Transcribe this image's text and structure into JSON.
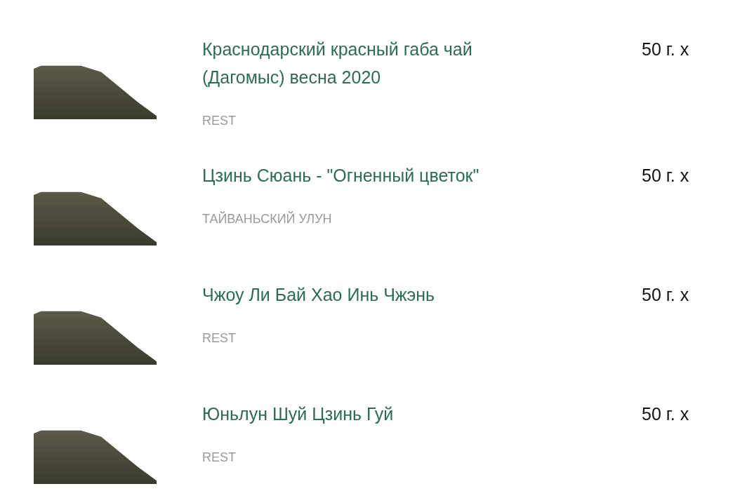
{
  "products": [
    {
      "title": "Краснодарский красный габа чай (Дагомыс) весна 2020",
      "category": "REST",
      "price": "50 г. х"
    },
    {
      "title": "Цзинь Сюань - \"Огненный цветок\"",
      "category": "ТАЙВАНЬСКИЙ УЛУН",
      "price": "50 г. х"
    },
    {
      "title": "Чжоу Ли Бай Хао Инь Чжэнь",
      "category": "REST",
      "price": "50 г. х"
    },
    {
      "title": "Юньлун Шуй Цзинь Гуй",
      "category": "REST",
      "price": "50 г. х"
    }
  ]
}
